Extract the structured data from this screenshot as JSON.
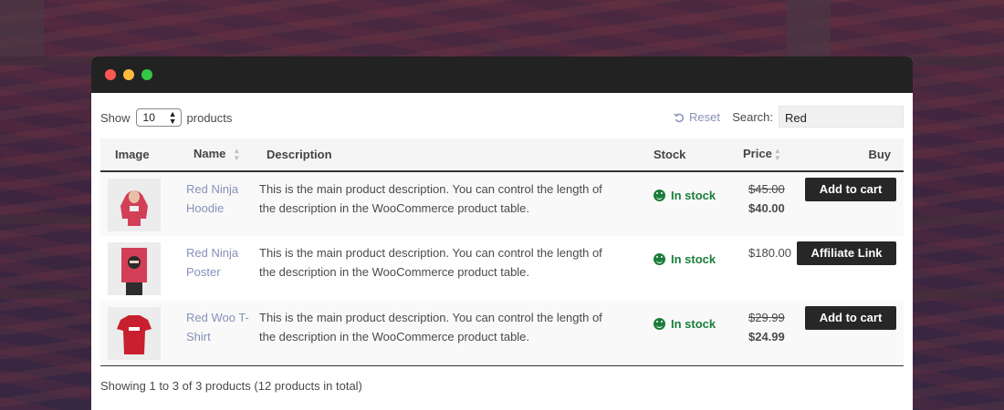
{
  "window": {
    "traffic_lights": [
      "close",
      "minimize",
      "maximize"
    ]
  },
  "controls": {
    "show_label": "Show",
    "per_page_value": "10",
    "products_label": "products",
    "reset_label": "Reset",
    "search_label": "Search:",
    "search_value": "Red"
  },
  "table": {
    "headers": [
      "Image",
      "Name",
      "Description",
      "Stock",
      "Price",
      "Buy"
    ],
    "rows": [
      {
        "name_line1": "Red Ninja",
        "name_line2": "Hoodie",
        "desc_line1": "This is the main product description. You can control the length of",
        "desc_line2": "the description in the WooCommerce product table.",
        "stock": "In stock",
        "price_old": "$45.00",
        "price_new": "$40.00",
        "button": "Add to cart",
        "image_icon": "hoodie-image"
      },
      {
        "name_line1": "Red Ninja",
        "name_line2": "Poster",
        "desc_line1": "This is the main product description. You can control the length of",
        "desc_line2": "the description in the WooCommerce product table.",
        "stock": "In stock",
        "price": "$180.00",
        "button": "Affiliate Link",
        "image_icon": "poster-image"
      },
      {
        "name_line1": "Red Woo T-",
        "name_line2": "Shirt",
        "desc_line1": "This is the main product description. You can control the length of",
        "desc_line2": "the description in the WooCommerce product table.",
        "stock": "In stock",
        "price_old": "$29.99",
        "price_new": "$24.99",
        "button": "Add to cart",
        "image_icon": "tshirt-image"
      }
    ]
  },
  "footer": {
    "info": "Showing 1 to 3 of 3 products (12 products in total)"
  },
  "colors": {
    "link": "#8791b8",
    "in_stock": "#1a7e3a",
    "button_bg": "#272727",
    "titlebar": "#222222"
  }
}
